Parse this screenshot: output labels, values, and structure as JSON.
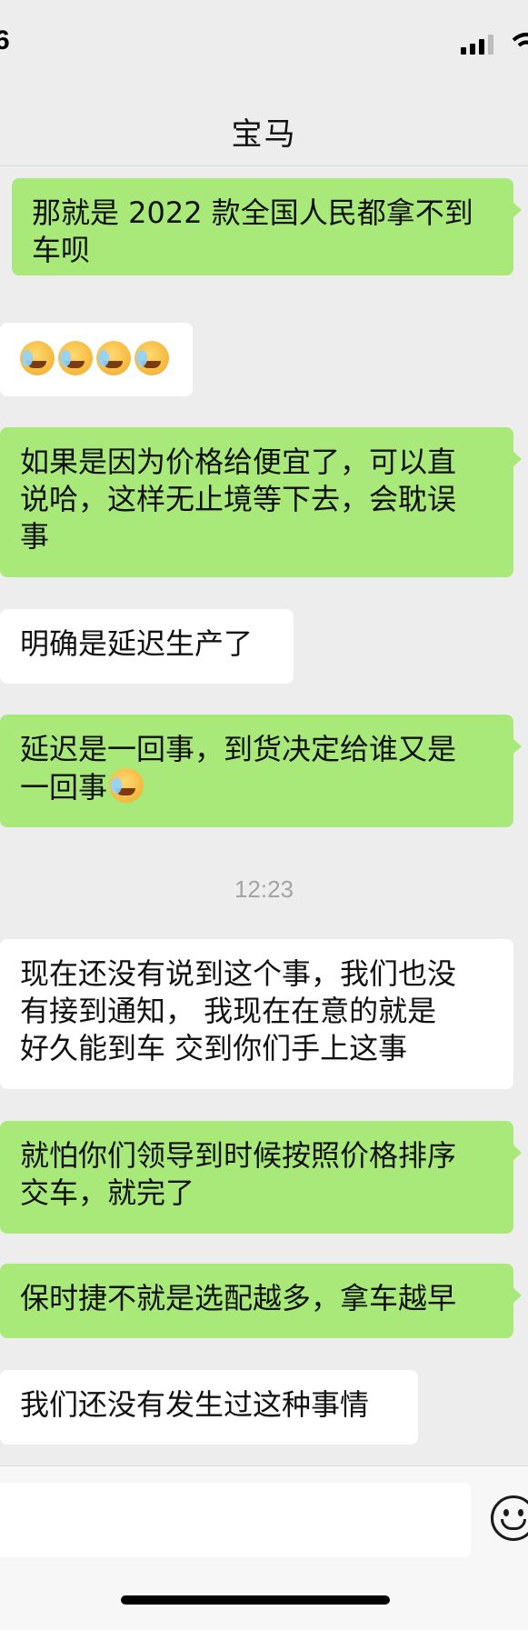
{
  "status_bar": {
    "time": "6"
  },
  "header": {
    "title": "宝马"
  },
  "messages": [
    {
      "side": "out",
      "text": "那就是 2022 款全国人民都拿不到\n车呗"
    },
    {
      "side": "in",
      "emoji_count": 4,
      "emoji_name": "laughing-crying-emoji"
    },
    {
      "side": "out",
      "text": "如果是因为价格给便宜了，可以直\n说哈，这样无止境等下去，会耽误\n事"
    },
    {
      "side": "in",
      "text": "明确是延迟生产了"
    },
    {
      "side": "out",
      "text": "延迟是一回事，到货决定给谁又是\n一回事"
    },
    {
      "side": "in",
      "text": "现在还没有说到这个事，我们也没\n有接到通知， 我现在在意的就是\n好久能到车 交到你们手上这事"
    },
    {
      "side": "out",
      "text": "就怕你们领导到时候按照价格排序\n交车，就完了"
    },
    {
      "side": "out",
      "text": "保时捷不就是选配越多，拿车越早"
    },
    {
      "side": "in",
      "text": "我们还没有发生过这种事情"
    }
  ],
  "timestamp": "12:23",
  "colors": {
    "outgoing_bubble": "#a9e97a",
    "incoming_bubble": "#ffffff",
    "background": "#ededed"
  },
  "input_bar": {
    "value": "",
    "emoji_icon": "smiley-face-icon"
  }
}
